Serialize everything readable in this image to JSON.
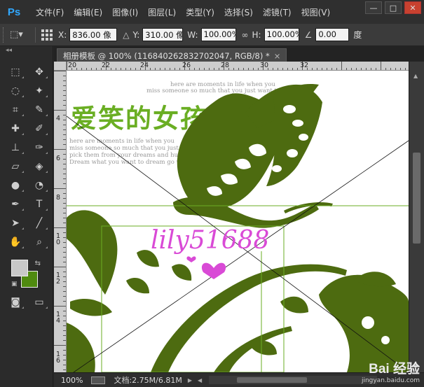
{
  "app": {
    "logo": "Ps"
  },
  "menu": [
    "文件(F)",
    "编辑(E)",
    "图像(I)",
    "图层(L)",
    "类型(Y)",
    "选择(S)",
    "滤镜(T)",
    "视图(V)"
  ],
  "window_controls": {
    "minimize": "—",
    "restore": "□",
    "close": "✕"
  },
  "options": {
    "x_label": "X:",
    "x_value": "836.00 像",
    "y_label": "Y:",
    "y_value": "310.00 像",
    "w_label": "W:",
    "w_value": "100.00%",
    "h_label": "H:",
    "h_value": "100.00%",
    "angle_value": "0.00",
    "angle_unit": "度"
  },
  "document": {
    "tab_title": "相册模板 @ 100% (116840262832702047, RGB/8) *",
    "tab_close": "×"
  },
  "rulers": {
    "horizontal": [
      "20",
      "22",
      "24",
      "26",
      "28",
      "30",
      "32"
    ],
    "vertical": [
      "4",
      "6",
      "8",
      "1\n0",
      "1\n2",
      "1\n4",
      "1\n6"
    ]
  },
  "canvas": {
    "headline": "爱笑的女孩",
    "top_lines": [
      "here are moments in life when you",
      "miss someone so much that you just want to"
    ],
    "body_lines": [
      "here are moments in life when you",
      "miss someone so much that you just want to",
      "pick them from your dreams and hug them for real",
      "Dream what you want to dream go where you"
    ],
    "watermark": "lily51688"
  },
  "status": {
    "zoom": "100%",
    "doc_size": "文档:2.75M/6.81M"
  },
  "badge": {
    "brand": "Bai 经验",
    "url": "jingyan.baidu.com"
  },
  "colors": {
    "foreground": "#c8c8c8",
    "background": "#4f8a0f",
    "art": "#4d6b10",
    "headline": "#6aae23",
    "watermark": "#d94ad6"
  }
}
